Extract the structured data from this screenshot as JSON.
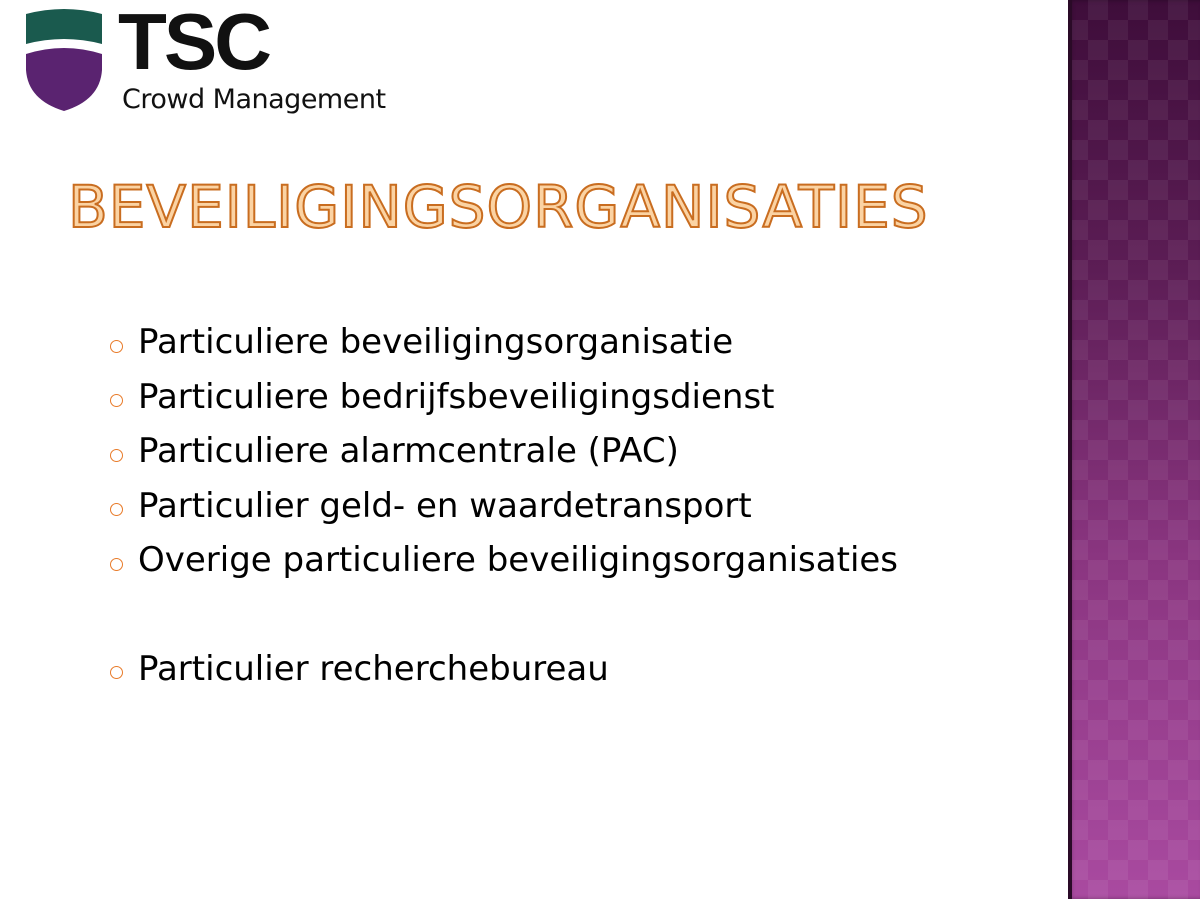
{
  "logo": {
    "wordmark": "TSC",
    "subtitle": "Crowd Management",
    "colors": {
      "top": "#1a5a4e",
      "bottom": "#5a2370"
    }
  },
  "title": "Beveiligingsorganisaties",
  "bullets": [
    {
      "text": "Particuliere beveiligingsorganisatie"
    },
    {
      "text": "Particuliere bedrijfsbeveiligingsdienst"
    },
    {
      "text": "Particuliere alarmcentrale (PAC)"
    },
    {
      "text": "Particulier geld- en waardetransport"
    },
    {
      "text": "Overige particuliere beveiligingsorganisaties"
    },
    {
      "text": "Particulier recherchebureau"
    }
  ],
  "colors": {
    "title_fill": "#fbd3a3",
    "title_outline": "#c96d20",
    "bullet": "#e87b2a",
    "side_band": "#7a2c70"
  }
}
